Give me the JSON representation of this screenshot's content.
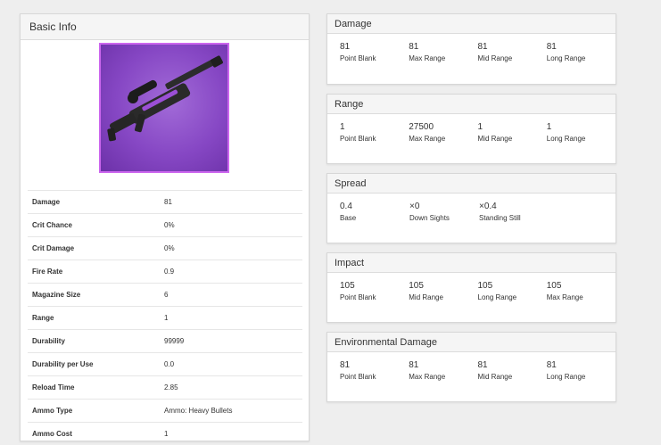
{
  "basic_info": {
    "title": "Basic Info",
    "weapon_image_desc": "purple heavy sniper rifle",
    "stats": [
      {
        "label": "Damage",
        "value": "81"
      },
      {
        "label": "Crit Chance",
        "value": "0%"
      },
      {
        "label": "Crit Damage",
        "value": "0%"
      },
      {
        "label": "Fire Rate",
        "value": "0.9"
      },
      {
        "label": "Magazine Size",
        "value": "6"
      },
      {
        "label": "Range",
        "value": "1"
      },
      {
        "label": "Durability",
        "value": "99999"
      },
      {
        "label": "Durability per Use",
        "value": "0.0"
      },
      {
        "label": "Reload Time",
        "value": "2.85"
      },
      {
        "label": "Ammo Type",
        "value": "Ammo: Heavy Bullets"
      },
      {
        "label": "Ammo Cost",
        "value": "1"
      }
    ]
  },
  "damage": {
    "title": "Damage",
    "fields": [
      {
        "value": "81",
        "label": "Point Blank"
      },
      {
        "value": "81",
        "label": "Max Range"
      },
      {
        "value": "81",
        "label": "Mid Range"
      },
      {
        "value": "81",
        "label": "Long Range"
      }
    ]
  },
  "range": {
    "title": "Range",
    "fields": [
      {
        "value": "1",
        "label": "Point Blank"
      },
      {
        "value": "27500",
        "label": "Max Range"
      },
      {
        "value": "1",
        "label": "Mid Range"
      },
      {
        "value": "1",
        "label": "Long Range"
      }
    ]
  },
  "spread": {
    "title": "Spread",
    "fields": [
      {
        "value": "0.4",
        "label": "Base"
      },
      {
        "value": "×0",
        "label": "Down Sights"
      },
      {
        "value": "×0.4",
        "label": "Standing Still"
      }
    ]
  },
  "impact": {
    "title": "Impact",
    "fields": [
      {
        "value": "105",
        "label": "Point Blank"
      },
      {
        "value": "105",
        "label": "Mid Range"
      },
      {
        "value": "105",
        "label": "Long Range"
      },
      {
        "value": "105",
        "label": "Max Range"
      }
    ]
  },
  "env_damage": {
    "title": "Environmental Damage",
    "fields": [
      {
        "value": "81",
        "label": "Point Blank"
      },
      {
        "value": "81",
        "label": "Max Range"
      },
      {
        "value": "81",
        "label": "Mid Range"
      },
      {
        "value": "81",
        "label": "Long Range"
      }
    ]
  },
  "colors": {
    "page_bg": "#eeeeee",
    "panel_header_bg": "#f5f5f5",
    "image_border": "#cc66ee",
    "image_bg": "#8647c4"
  }
}
